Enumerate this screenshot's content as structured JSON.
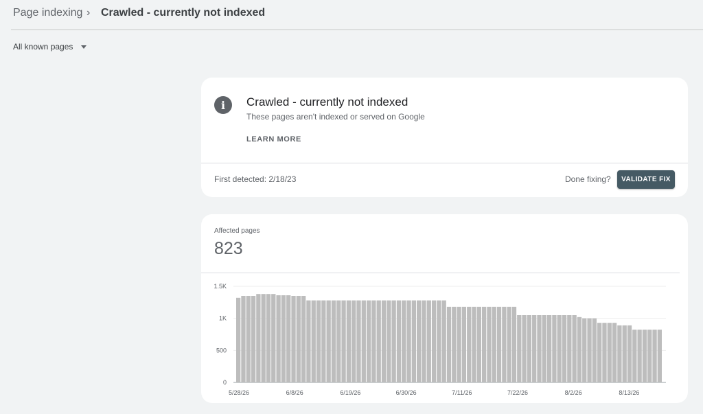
{
  "breadcrumb": {
    "parent": "Page indexing",
    "separator": "›",
    "current": "Crawled - currently not indexed"
  },
  "filter": {
    "selected": "All known pages"
  },
  "info_card": {
    "icon": "info-icon",
    "icon_glyph": "i",
    "title": "Crawled - currently not indexed",
    "subtitle": "These pages aren't indexed or served on Google",
    "learn_more": "LEARN MORE",
    "first_detected": "First detected: 2/18/23",
    "done_fixing": "Done fixing?",
    "validate_button": "VALIDATE FIX"
  },
  "colors": {
    "accent": "#455a64",
    "bar": "#bdbdbd",
    "background": "#f1f3f4"
  },
  "affected": {
    "label": "Affected pages",
    "value": "823"
  },
  "chart_data": {
    "type": "bar",
    "title": "",
    "xlabel": "",
    "ylabel": "",
    "ylim": [
      0,
      1500
    ],
    "y_ticks": [
      "1.5K",
      "1K",
      "500",
      "0"
    ],
    "y_tick_values": [
      1500,
      1000,
      500,
      0
    ],
    "x_tick_labels": [
      "5/28/26",
      "6/8/26",
      "6/19/26",
      "6/30/26",
      "7/11/26",
      "7/22/26",
      "8/2/26",
      "8/13/26"
    ],
    "grid": true,
    "series": [
      {
        "values": [
          1320,
          1350,
          1350,
          1350,
          1380,
          1380,
          1380,
          1380,
          1360,
          1360,
          1360,
          1350,
          1350,
          1350,
          1280,
          1280,
          1280,
          1280,
          1280,
          1280,
          1280,
          1280,
          1280,
          1280,
          1280,
          1280,
          1280,
          1280,
          1280,
          1280,
          1280,
          1280,
          1280,
          1280,
          1280,
          1280,
          1280,
          1280,
          1280,
          1280,
          1280,
          1280,
          1180,
          1180,
          1180,
          1180,
          1180,
          1180,
          1180,
          1180,
          1180,
          1180,
          1180,
          1180,
          1180,
          1180,
          1050,
          1050,
          1050,
          1050,
          1050,
          1050,
          1050,
          1050,
          1050,
          1050,
          1050,
          1050,
          1020,
          1000,
          1000,
          1000,
          930,
          930,
          930,
          930,
          890,
          890,
          890,
          823,
          823,
          823,
          823,
          823,
          823
        ]
      }
    ]
  }
}
